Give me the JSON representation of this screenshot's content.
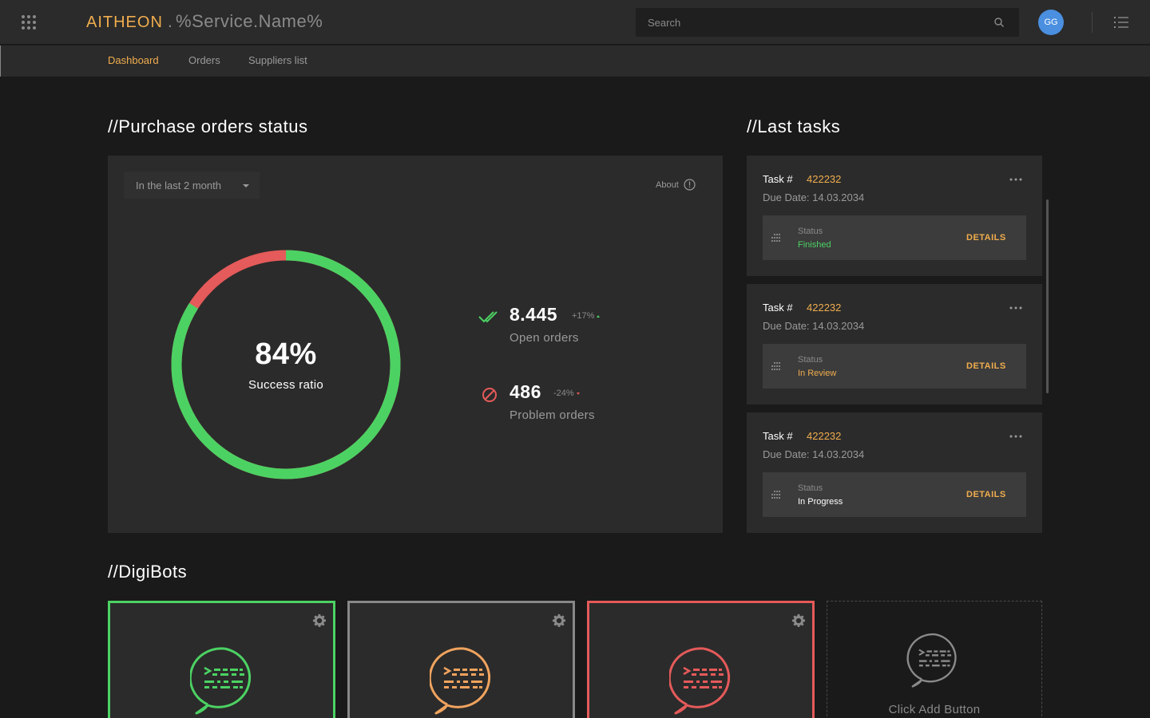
{
  "header": {
    "brand_logo": "AITHEON",
    "brand_dot": ".",
    "service_name": "%Service.Name%",
    "search_placeholder": "Search",
    "avatar_initials": "GG"
  },
  "nav": {
    "tabs": [
      {
        "label": "Dashboard",
        "active": true
      },
      {
        "label": "Orders",
        "active": false
      },
      {
        "label": "Suppliers list",
        "active": false
      }
    ]
  },
  "purchase": {
    "title": "//Purchase orders status",
    "period": "In the last 2 month",
    "about": "About",
    "success_pct": "84%",
    "success_label": "Success ratio",
    "success_value": 84,
    "open": {
      "value": "8.445",
      "delta": "+17%",
      "label": "Open orders"
    },
    "problem": {
      "value": "486",
      "delta": "-24%",
      "label": "Problem orders"
    }
  },
  "tasks": {
    "title": "//Last tasks",
    "task_label": "Task #",
    "status_label": "Status",
    "details_label": "DETAILS",
    "items": [
      {
        "number": "422232",
        "due": "Due Date: 14.03.2034",
        "status": "Finished",
        "status_color": "#4cd263"
      },
      {
        "number": "422232",
        "due": "Due Date: 14.03.2034",
        "status": "In Review",
        "status_color": "#f0ad4e"
      },
      {
        "number": "422232",
        "due": "Due Date: 14.03.2034",
        "status": "In Progress",
        "status_color": "#ffffff"
      }
    ]
  },
  "digibots": {
    "title": "//DigiBots",
    "bots": [
      {
        "border": "#4cd263",
        "icon_color": "#4cd263"
      },
      {
        "border": "#888888",
        "icon_color": "#f0a35e"
      },
      {
        "border": "#e55a5a",
        "icon_color": "#e55a5a"
      }
    ],
    "add_label": "Click Add Button"
  },
  "colors": {
    "accent": "#f0ad4e",
    "success": "#4cd263",
    "danger": "#e55a5a"
  }
}
